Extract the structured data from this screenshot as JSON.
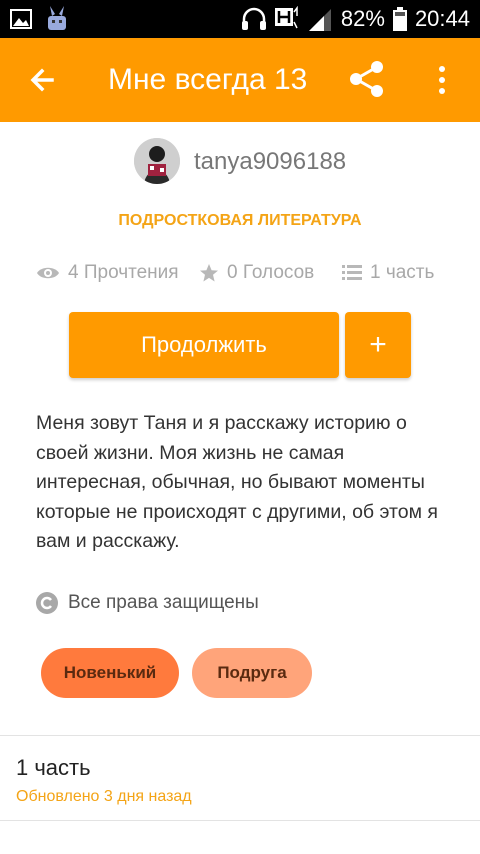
{
  "status_bar": {
    "battery": "82%",
    "time": "20:44"
  },
  "toolbar": {
    "title": "Мне всегда 13",
    "back_icon": "arrow-left-icon",
    "share_icon": "share-icon",
    "more_icon": "more-vert-icon"
  },
  "story": {
    "author": "tanya9096188",
    "category": "ПОДРОСТКОВАЯ ЛИТЕРАТУРА",
    "reads": "4 Прочтения",
    "votes": "0 Голосов",
    "parts": "1 часть",
    "description": "Меня зовут Таня и я расскажу историю о своей жизни.  Моя жизнь не самая интересная, обычная, но бывают моменты которые не происходят с другими,  об этом я вам и расскажу.",
    "copyright": "Все права защищены",
    "tags": [
      "Новенький",
      "Подруга"
    ]
  },
  "buttons": {
    "continue": "Продолжить",
    "add": "+"
  },
  "part_list": [
    {
      "title": "1 часть",
      "updated": "Обновлено 3 дня назад"
    }
  ],
  "colors": {
    "accent": "#ff9a00",
    "category": "#f4a416",
    "tag1": "#ff7a3d",
    "tag2": "#ffa47a"
  }
}
